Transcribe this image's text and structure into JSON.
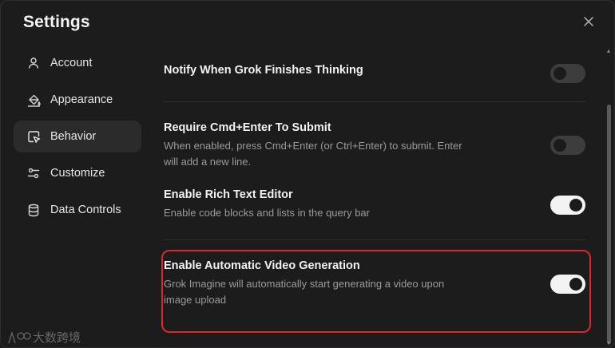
{
  "dialog": {
    "title": "Settings"
  },
  "sidebar": {
    "items": [
      {
        "label": "Account",
        "icon": "user-icon"
      },
      {
        "label": "Appearance",
        "icon": "paint-bucket-icon"
      },
      {
        "label": "Behavior",
        "icon": "cursor-window-icon",
        "active": true
      },
      {
        "label": "Customize",
        "icon": "sliders-icon"
      },
      {
        "label": "Data Controls",
        "icon": "database-icon"
      }
    ]
  },
  "settings": [
    {
      "label": "Notify When Grok Finishes Thinking",
      "desc": "",
      "enabled": false
    },
    {
      "label": "Require Cmd+Enter To Submit",
      "desc": "When enabled, press Cmd+Enter (or Ctrl+Enter) to submit. Enter will add a new line.",
      "enabled": false
    },
    {
      "label": "Enable Rich Text Editor",
      "desc": "Enable code blocks and lists in the query bar",
      "enabled": true
    },
    {
      "label": "Enable Automatic Video Generation",
      "desc": "Grok Imagine will automatically start generating a video upon image upload",
      "enabled": true
    }
  ],
  "watermark": {
    "logo_text": "100",
    "text": "大数跨境"
  },
  "colors": {
    "background": "#1c1c1c",
    "active_nav": "#2b2b2b",
    "highlight": "#e0262b",
    "toggle_on": "#f3f3f3",
    "toggle_off": "#3d3d3d"
  }
}
